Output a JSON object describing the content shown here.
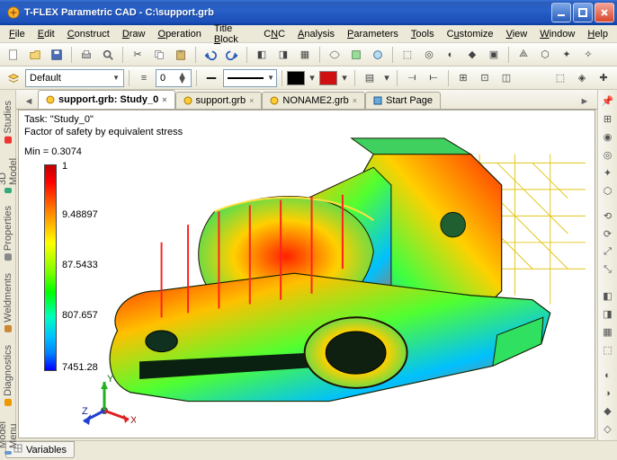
{
  "window": {
    "title": "T-FLEX Parametric CAD - C:\\support.grb"
  },
  "menu": {
    "items": [
      "File",
      "Edit",
      "Construct",
      "Draw",
      "Operation",
      "Title Block",
      "CNC",
      "Analysis",
      "Parameters",
      "Tools",
      "Customize",
      "View",
      "Window",
      "Help"
    ]
  },
  "toolbar2": {
    "layer_combo": "Default",
    "spin_value": "0",
    "color_black": "#000000",
    "color_red": "#d01010"
  },
  "left_tabs": [
    "Studies",
    "3D Model",
    "Properties",
    "Weldments",
    "Diagnostics",
    "Model Menu"
  ],
  "doc_tabs": [
    {
      "label": "support.grb: Study_0",
      "active": true
    },
    {
      "label": "support.grb",
      "active": false
    },
    {
      "label": "NONAME2.grb",
      "active": false
    },
    {
      "label": "Start Page",
      "active": false
    }
  ],
  "canvas": {
    "task_label": "Task:",
    "task_value": "\"Study_0\"",
    "factor_label": "Factor of safety by equivalent stress",
    "min_label": "Min =",
    "min_value": "0.3074"
  },
  "legend": {
    "values": [
      "1",
      "9.48897",
      "87.5433",
      "807.657",
      "7451.28"
    ]
  },
  "axis": {
    "x": "X",
    "y": "Y",
    "z": "Z"
  },
  "bottom_tab": "Variables"
}
